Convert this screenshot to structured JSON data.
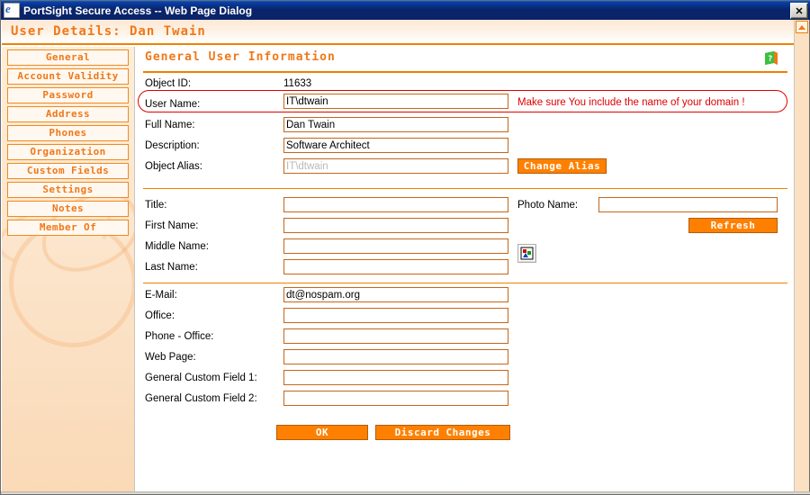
{
  "window": {
    "title": "PortSight Secure Access -- Web Page Dialog",
    "app_icon": "ie-page-icon",
    "close_label": "✕"
  },
  "header": {
    "title": "User Details: Dan Twain"
  },
  "sidebar": {
    "items": [
      {
        "label": "General"
      },
      {
        "label": "Account Validity"
      },
      {
        "label": "Password"
      },
      {
        "label": "Address"
      },
      {
        "label": "Phones"
      },
      {
        "label": "Organization"
      },
      {
        "label": "Custom Fields"
      },
      {
        "label": "Settings"
      },
      {
        "label": "Notes"
      },
      {
        "label": "Member Of"
      }
    ]
  },
  "content": {
    "section_title": "General User Information",
    "help_icon": "help-book-icon",
    "object_id_label": "Object ID:",
    "object_id_value": "11633",
    "user_name_label": "User Name:",
    "user_name_value": "IT\\dtwain",
    "user_name_warning": "Make sure You include the name of your domain !",
    "full_name_label": "Full Name:",
    "full_name_value": "Dan Twain",
    "description_label": "Description:",
    "description_value": "Software Architect",
    "object_alias_label": "Object Alias:",
    "object_alias_value": "IT\\dtwain",
    "change_alias_label": "Change Alias",
    "title_label": "Title:",
    "title_value": "",
    "first_name_label": "First Name:",
    "first_name_value": "",
    "middle_name_label": "Middle Name:",
    "middle_name_value": "",
    "last_name_label": "Last Name:",
    "last_name_value": "",
    "photo_name_label": "Photo Name:",
    "photo_name_value": "",
    "refresh_label": "Refresh",
    "photo_preview_icon": "broken-image-icon",
    "email_label": "E-Mail:",
    "email_value": "dt@nospam.org",
    "office_label": "Office:",
    "office_value": "",
    "phone_office_label": "Phone - Office:",
    "phone_office_value": "",
    "web_page_label": "Web Page:",
    "web_page_value": "",
    "custom_field_1_label": "General Custom Field 1:",
    "custom_field_1_value": "",
    "custom_field_2_label": "General Custom Field 2:",
    "custom_field_2_value": "",
    "ok_label": "OK",
    "discard_label": "Discard Changes"
  },
  "colors": {
    "accent_orange": "#ff8000",
    "text_orange": "#f07818",
    "field_border": "#c4661a",
    "warning_red": "#e00000",
    "titlebar_blue": "#0a246a"
  }
}
